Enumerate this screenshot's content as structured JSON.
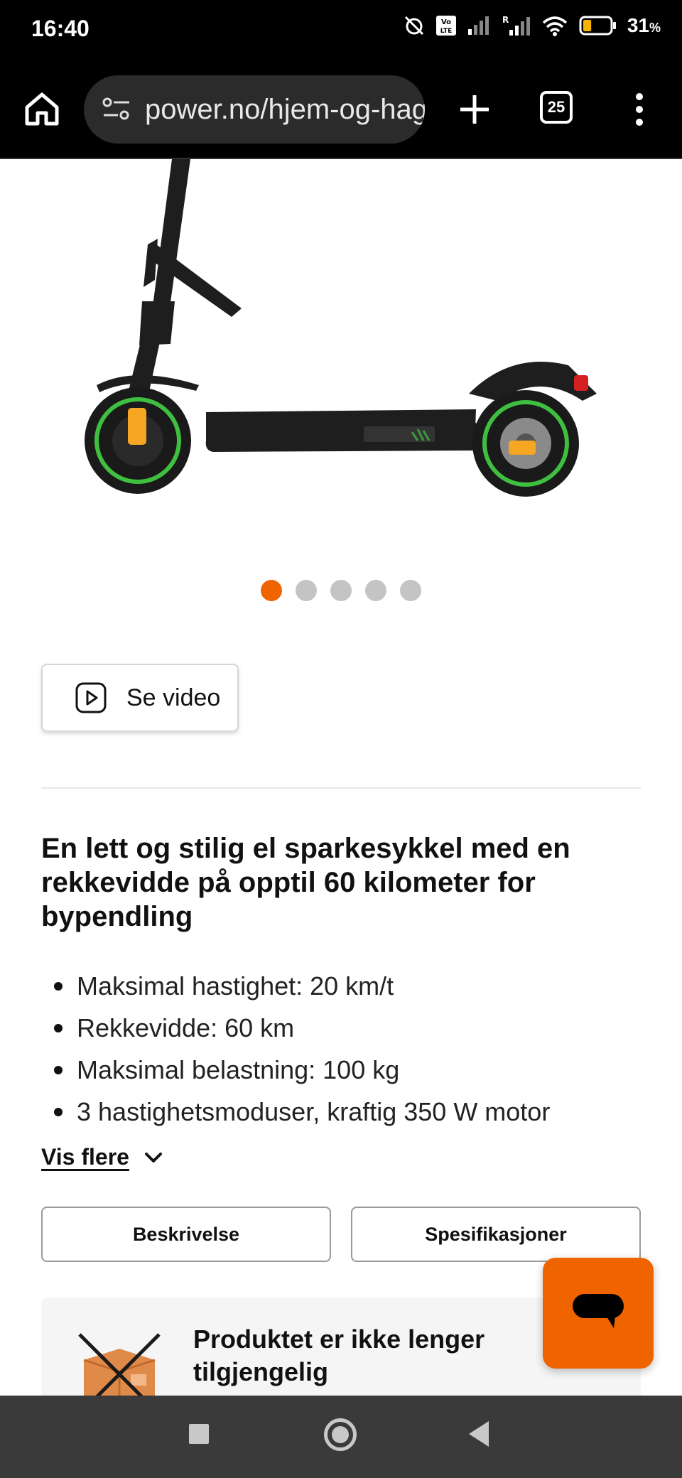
{
  "status_bar": {
    "time": "16:40",
    "network_badge": "Vo LTE",
    "roaming": "R",
    "battery_percent": "31",
    "battery_unit": "%",
    "battery_level": 0.31
  },
  "browser": {
    "url": "power.no/hjem-og-hage",
    "tab_count": "25",
    "icons": [
      "home-icon",
      "site-settings-icon",
      "plus-icon",
      "tabs-icon",
      "more-vert-icon"
    ]
  },
  "product": {
    "carousel": {
      "total": 5,
      "active_index": 0
    },
    "video_button_label": "Se video",
    "headline": "En lett og stilig el sparkesykkel med en rekkevidde på opptil 60 kilometer for bypendling",
    "features": [
      "Maksimal hastighet: 20 km/t",
      "Rekkevidde: 60 km",
      "Maksimal belastning: 100 kg",
      "3 hastighetsmoduser, kraftig 350 W motor"
    ],
    "show_more_label": "Vis flere",
    "tabs": {
      "description": "Beskrivelse",
      "specifications": "Spesifikasjoner"
    },
    "unavailable_text": "Produktet er ikke lenger tilgjengelig"
  },
  "colors": {
    "accent": "#f06400",
    "tire_green": "#3fbf3f",
    "reflector": "#f5a623"
  }
}
